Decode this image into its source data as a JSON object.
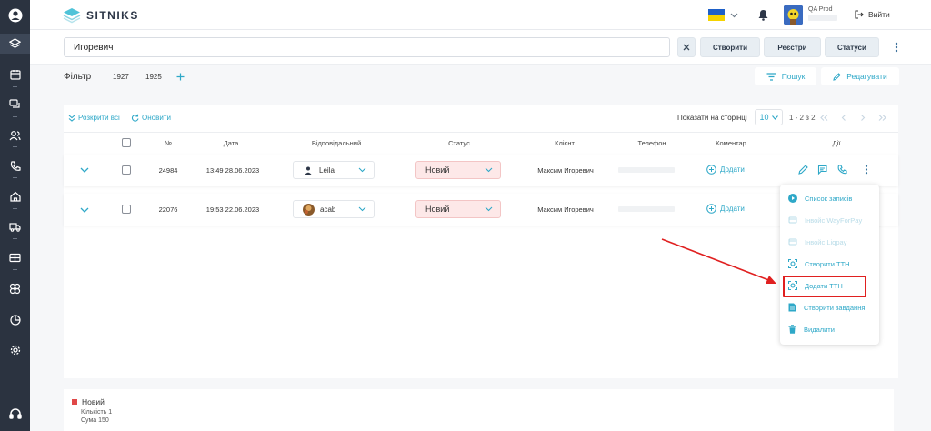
{
  "brand": {
    "name": "SITNIKS"
  },
  "header": {
    "user_name": "QA Prod",
    "logout_label": "Вийти"
  },
  "search": {
    "value": "Игоревич"
  },
  "toolbar": {
    "create_label": "Створити",
    "registry_label": "Реєстри",
    "statuses_label": "Статуси"
  },
  "filter": {
    "label": "Фільтр",
    "presets": [
      "1927",
      "1925"
    ],
    "search_label": "Пошук",
    "edit_label": "Редагувати"
  },
  "table_controls": {
    "expand_all_label": "Розкрити всі",
    "refresh_label": "Оновити",
    "per_page_label": "Показати на сторінці",
    "per_page_value": "10",
    "range_text": "1 - 2 з 2"
  },
  "table": {
    "columns": {
      "number": "№",
      "date": "Дата",
      "responsible": "Відповідальний",
      "status": "Статус",
      "client": "Клієнт",
      "phone": "Телефон",
      "comment": "Коментар",
      "actions": "Дії"
    },
    "rows": [
      {
        "number": "24984",
        "date": "13:49 28.06.2023",
        "responsible": "Leila",
        "status": "Новий",
        "client": "Максим Игоревич",
        "comment_action": "Додати"
      },
      {
        "number": "22076",
        "date": "19:53 22.06.2023",
        "responsible": "acab",
        "status": "Новий",
        "client": "Максим Игоревич",
        "comment_action": "Додати"
      }
    ]
  },
  "actions_menu": {
    "items": [
      {
        "label": "Список записів",
        "icon": "play-circle-icon",
        "disabled": false
      },
      {
        "label": "Інвойс WayForPay",
        "icon": "invoice-icon",
        "disabled": true
      },
      {
        "label": "Інвойс Liqpay",
        "icon": "invoice-icon",
        "disabled": true
      },
      {
        "label": "Створити ТТН",
        "icon": "scan-box-icon",
        "disabled": false
      },
      {
        "label": "Додати ТТН",
        "icon": "scan-box-icon",
        "disabled": false,
        "highlighted": true
      },
      {
        "label": "Створити завдання",
        "icon": "document-icon",
        "disabled": false
      },
      {
        "label": "Видалити",
        "icon": "trash-icon",
        "disabled": false
      }
    ]
  },
  "summary": {
    "status_label": "Новий",
    "count_text": "Кількість 1",
    "sum_text": "Сума 150"
  },
  "colors": {
    "sidebar": "#2b3340",
    "accent": "#2ea8c8",
    "status_new_bg": "#fde8e8",
    "status_dot": "#e04848",
    "highlight": "#e02020"
  },
  "sidebar_icons": [
    "user-circle-icon",
    "layers-icon",
    "calendar-icon",
    "chat-icon",
    "people-icon",
    "phone-icon",
    "home-icon",
    "truck-icon",
    "ticket-icon",
    "puzzle-icon",
    "pie-chart-icon",
    "settings-icon",
    "headset-icon"
  ]
}
